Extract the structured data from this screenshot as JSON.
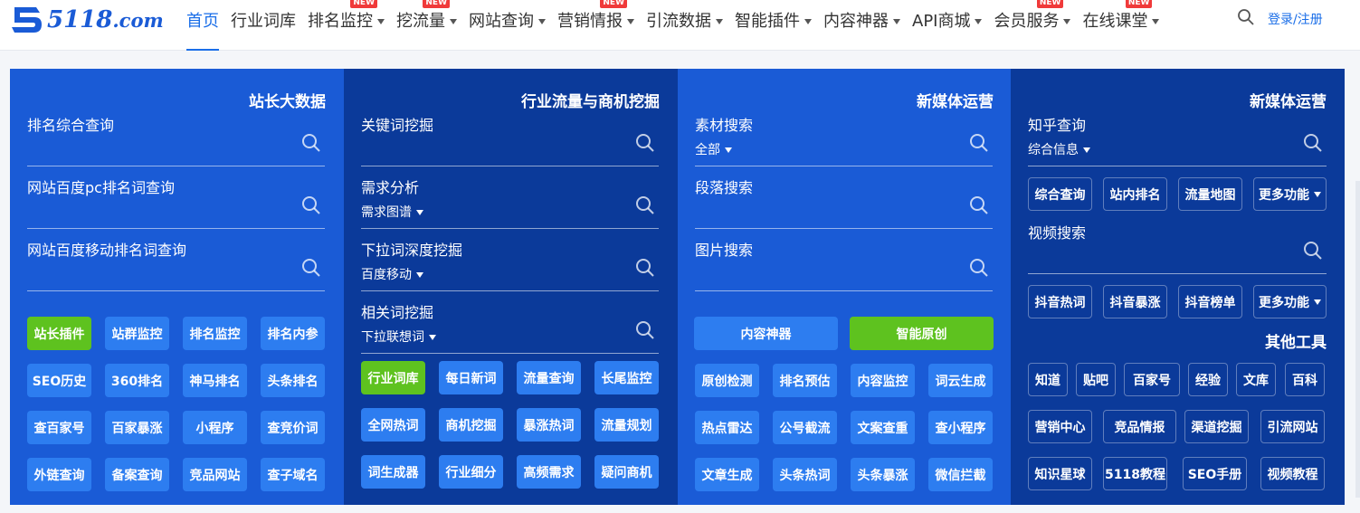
{
  "header": {
    "logo_text": "5118",
    "logo_suffix": ".com",
    "nav": [
      {
        "label": "首页",
        "dropdown": false,
        "new": false
      },
      {
        "label": "行业词库",
        "dropdown": false,
        "new": false
      },
      {
        "label": "排名监控",
        "dropdown": true,
        "new": true
      },
      {
        "label": "挖流量",
        "dropdown": true,
        "new": true
      },
      {
        "label": "网站查询",
        "dropdown": true,
        "new": false
      },
      {
        "label": "营销情报",
        "dropdown": true,
        "new": true
      },
      {
        "label": "引流数据",
        "dropdown": true,
        "new": false
      },
      {
        "label": "智能插件",
        "dropdown": true,
        "new": false
      },
      {
        "label": "内容神器",
        "dropdown": true,
        "new": false
      },
      {
        "label": "API商城",
        "dropdown": true,
        "new": false
      },
      {
        "label": "会员服务",
        "dropdown": true,
        "new": true
      },
      {
        "label": "在线课堂",
        "dropdown": true,
        "new": true
      }
    ],
    "new_badge": "NEW",
    "login": "登录/注册"
  },
  "columns": {
    "c1": {
      "title": "站长大数据",
      "fields": [
        {
          "label": "排名综合查询",
          "select": ""
        },
        {
          "label": "网站百度pc排名词查询",
          "select": ""
        },
        {
          "label": "网站百度移动排名词查询",
          "select": ""
        }
      ],
      "buttons": [
        "站长插件",
        "站群监控",
        "排名监控",
        "排名内参",
        "SEO历史",
        "360排名",
        "神马排名",
        "头条排名",
        "查百家号",
        "百家暴涨",
        "小程序",
        "查竞价词",
        "外链查询",
        "备案查询",
        "竞品网站",
        "查子域名"
      ]
    },
    "c2": {
      "title": "行业流量与商机挖掘",
      "fields": [
        {
          "label": "关键词挖掘",
          "select": ""
        },
        {
          "label": "需求分析",
          "select": "需求图谱"
        },
        {
          "label": "下拉词深度挖掘",
          "select": "百度移动"
        },
        {
          "label": "相关词挖掘",
          "select": "下拉联想词"
        }
      ],
      "buttons": [
        "行业词库",
        "每日新词",
        "流量查询",
        "长尾监控",
        "全网热词",
        "商机挖掘",
        "暴涨热词",
        "流量规划",
        "词生成器",
        "行业细分",
        "高频需求",
        "疑问商机"
      ]
    },
    "c3": {
      "title": "新媒体运营",
      "fields": [
        {
          "label": "素材搜索",
          "select": "全部"
        },
        {
          "label": "段落搜索",
          "select": ""
        },
        {
          "label": "图片搜索",
          "select": ""
        }
      ],
      "big_buttons": [
        "内容神器",
        "智能原创"
      ],
      "buttons": [
        "原创检测",
        "排名预估",
        "内容监控",
        "词云生成",
        "热点雷达",
        "公号截流",
        "文案查重",
        "查小程序",
        "文章生成",
        "头条热词",
        "头条暴涨",
        "微信拦截"
      ]
    },
    "c4": {
      "title": "新媒体运营",
      "field_zhihu": {
        "label": "知乎查询",
        "select": "综合信息"
      },
      "zhihu_buttons": [
        "综合查询",
        "站内排名",
        "流量地图",
        "更多功能"
      ],
      "field_video": {
        "label": "视频搜索",
        "select": ""
      },
      "video_buttons": [
        "抖音热词",
        "抖音暴涨",
        "抖音榜单",
        "更多功能"
      ],
      "other_title": "其他工具",
      "tools_row1": [
        "知道",
        "贴吧",
        "百家号",
        "经验",
        "文库",
        "百科"
      ],
      "tools_row2": [
        "营销中心",
        "竞品情报",
        "渠道挖掘",
        "引流网站"
      ],
      "tools_row3": [
        "知识星球",
        "5118教程",
        "SEO手册",
        "视频教程"
      ]
    }
  },
  "colors": {
    "blue": "#1a5bd6",
    "dark_blue": "#0b3a9a",
    "button": "#2d7df0",
    "green": "#5ec21f",
    "badge": "#f03a3a"
  }
}
